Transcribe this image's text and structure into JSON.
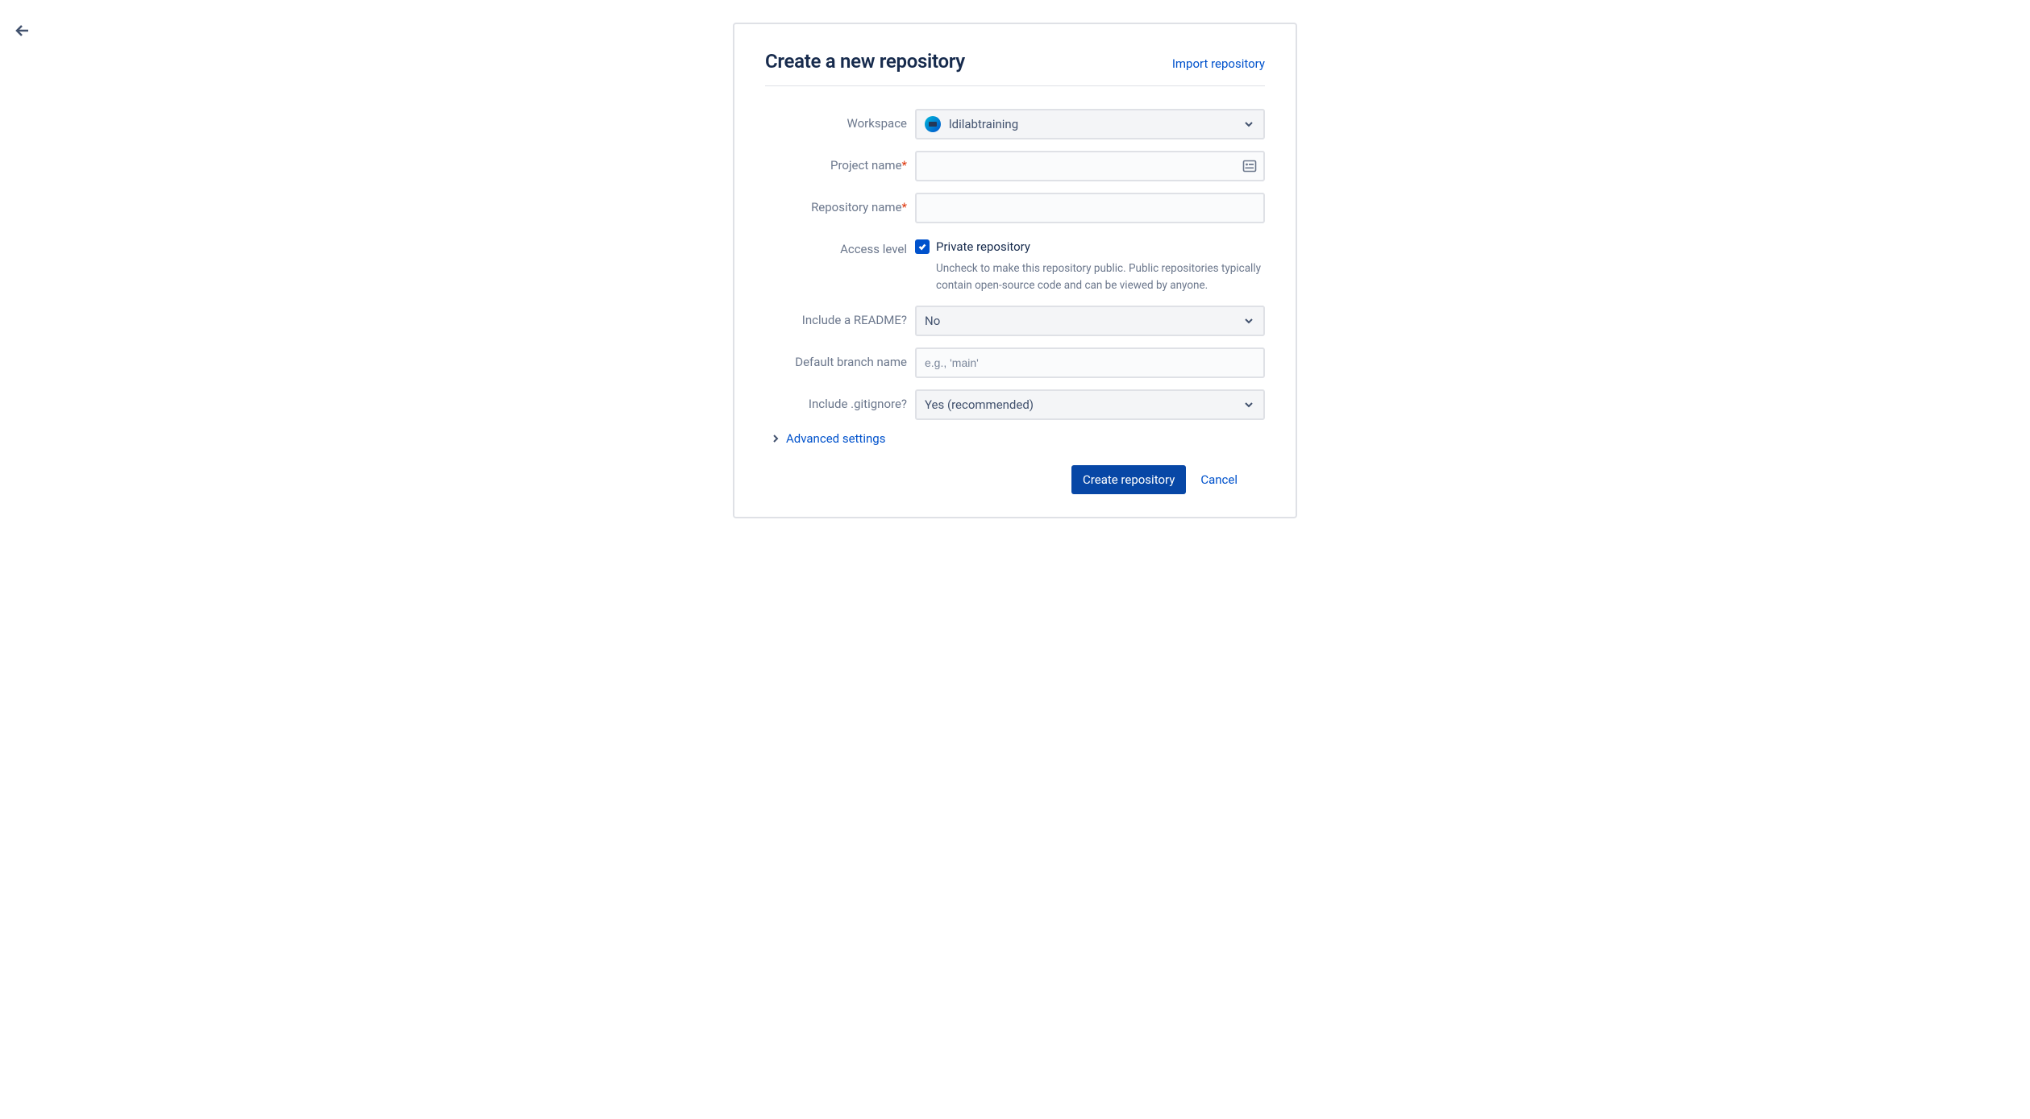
{
  "header": {
    "title": "Create a new repository",
    "import_link": "Import repository"
  },
  "form": {
    "workspace": {
      "label": "Workspace",
      "value": "ldilabtraining"
    },
    "project_name": {
      "label": "Project name",
      "required_mark": "*",
      "value": ""
    },
    "repository_name": {
      "label": "Repository name",
      "required_mark": "*",
      "value": ""
    },
    "access_level": {
      "label": "Access level",
      "checkbox_label": "Private repository",
      "help_text": "Uncheck to make this repository public. Public repositories typically contain open-source code and can be viewed by anyone."
    },
    "include_readme": {
      "label": "Include a README?",
      "value": "No"
    },
    "default_branch": {
      "label": "Default branch name",
      "placeholder": "e.g., 'main'",
      "value": ""
    },
    "include_gitignore": {
      "label": "Include .gitignore?",
      "value": "Yes (recommended)"
    },
    "advanced_settings": "Advanced settings"
  },
  "buttons": {
    "create": "Create repository",
    "cancel": "Cancel"
  }
}
